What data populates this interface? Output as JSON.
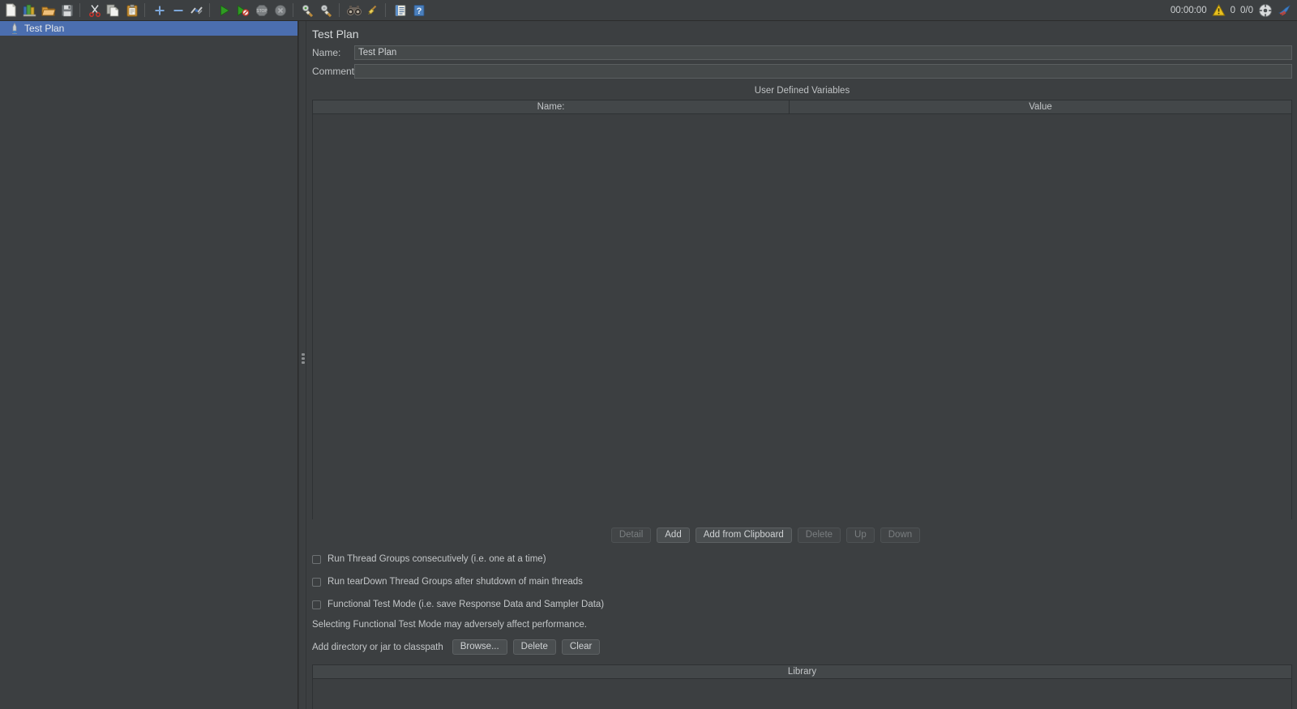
{
  "toolbar": {
    "buttons": [
      {
        "name": "new-icon",
        "tooltip": "New"
      },
      {
        "name": "templates-icon",
        "tooltip": "Templates"
      },
      {
        "name": "open-icon",
        "tooltip": "Open"
      },
      {
        "name": "save-icon",
        "tooltip": "Save Test Plan"
      },
      {
        "name": "cut-icon",
        "tooltip": "Cut"
      },
      {
        "name": "copy-icon",
        "tooltip": "Copy"
      },
      {
        "name": "paste-icon",
        "tooltip": "Paste"
      },
      {
        "name": "expand-all-icon",
        "tooltip": "Expand All"
      },
      {
        "name": "collapse-all-icon",
        "tooltip": "Collapse All"
      },
      {
        "name": "toggle-icon",
        "tooltip": "Toggle"
      },
      {
        "name": "start-icon",
        "tooltip": "Start"
      },
      {
        "name": "start-no-pauses-icon",
        "tooltip": "Start no pauses"
      },
      {
        "name": "stop-icon",
        "tooltip": "Stop"
      },
      {
        "name": "shutdown-icon",
        "tooltip": "Shutdown"
      },
      {
        "name": "clear-icon",
        "tooltip": "Clear"
      },
      {
        "name": "clear-all-icon",
        "tooltip": "Clear All"
      },
      {
        "name": "search-icon",
        "tooltip": "Search"
      },
      {
        "name": "reset-search-icon",
        "tooltip": "Reset Search"
      },
      {
        "name": "function-helper-icon",
        "tooltip": "Function Helper Dialog"
      },
      {
        "name": "help-icon",
        "tooltip": "Help"
      }
    ],
    "status": {
      "elapsed_time": "00:00:00",
      "warning_count": "0",
      "threads": "0/0"
    }
  },
  "tree": {
    "nodes": [
      {
        "label": "Test Plan",
        "icon": "test-plan-icon",
        "selected": true
      }
    ]
  },
  "panel": {
    "title": "Test Plan",
    "name_label": "Name:",
    "name_value": "Test Plan",
    "comments_label": "Comments:",
    "comments_value": "",
    "comments_placeholder": "",
    "udv": {
      "section_title": "User Defined Variables",
      "columns": [
        "Name:",
        "Value"
      ],
      "rows": [],
      "buttons": [
        {
          "label": "Detail",
          "enabled": false
        },
        {
          "label": "Add",
          "enabled": true
        },
        {
          "label": "Add from Clipboard",
          "enabled": true
        },
        {
          "label": "Delete",
          "enabled": false
        },
        {
          "label": "Up",
          "enabled": false
        },
        {
          "label": "Down",
          "enabled": false
        }
      ]
    },
    "checkboxes": [
      {
        "label": "Run Thread Groups consecutively (i.e. one at a time)",
        "checked": false
      },
      {
        "label": "Run tearDown Thread Groups after shutdown of main threads",
        "checked": false
      },
      {
        "label": "Functional Test Mode (i.e. save Response Data and Sampler Data)",
        "checked": false
      }
    ],
    "functional_note": "Selecting Functional Test Mode may adversely affect performance.",
    "classpath": {
      "label": "Add directory or jar to classpath",
      "buttons": [
        {
          "label": "Browse...",
          "enabled": true
        },
        {
          "label": "Delete",
          "enabled": true
        },
        {
          "label": "Clear",
          "enabled": true
        }
      ]
    },
    "library": {
      "header": "Library",
      "rows": []
    }
  },
  "colors": {
    "background": "#3c3f41",
    "selection": "#4b6eaf",
    "field_bg": "#45494a",
    "border": "#2e3133",
    "text": "#bbbbbb",
    "accent_green": "#37a02a",
    "warning_yellow": "#e8c020"
  }
}
